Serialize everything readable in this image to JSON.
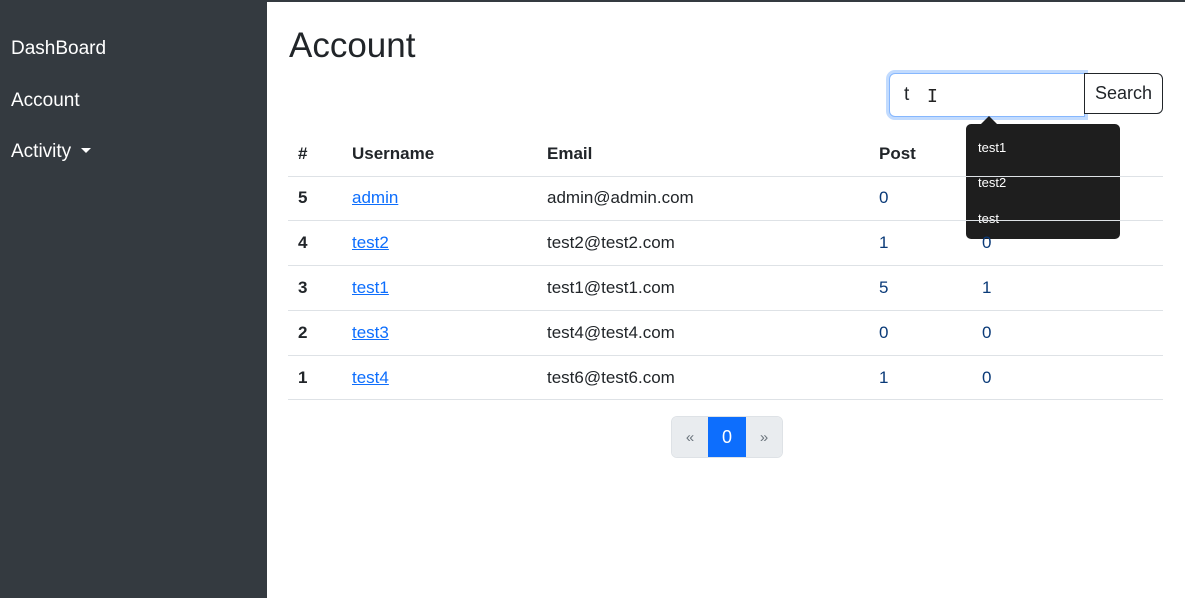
{
  "sidebar": {
    "items": [
      {
        "label": "DashBoard"
      },
      {
        "label": "Account"
      },
      {
        "label": "Activity"
      }
    ]
  },
  "main": {
    "title": "Account",
    "search": {
      "value": "t",
      "button_label": "Search"
    },
    "suggestions": [
      "test1",
      "test2",
      "test"
    ],
    "table": {
      "headers": [
        "#",
        "Username",
        "Email",
        "Post",
        ""
      ],
      "rows": [
        {
          "id": "5",
          "username": "admin",
          "email": "admin@admin.com",
          "post": "0",
          "extra": ""
        },
        {
          "id": "4",
          "username": "test2",
          "email": "test2@test2.com",
          "post": "1",
          "extra": "0"
        },
        {
          "id": "3",
          "username": "test1",
          "email": "test1@test1.com",
          "post": "5",
          "extra": "1"
        },
        {
          "id": "2",
          "username": "test3",
          "email": "test4@test4.com",
          "post": "0",
          "extra": "0"
        },
        {
          "id": "1",
          "username": "test4",
          "email": "test6@test6.com",
          "post": "1",
          "extra": "0"
        }
      ]
    },
    "pagination": {
      "prev": "«",
      "current": "0",
      "next": "»"
    }
  },
  "colors": {
    "sidebar_bg": "#343a40",
    "accent": "#0d6efd",
    "tooltip_bg": "#1e1e1e"
  }
}
